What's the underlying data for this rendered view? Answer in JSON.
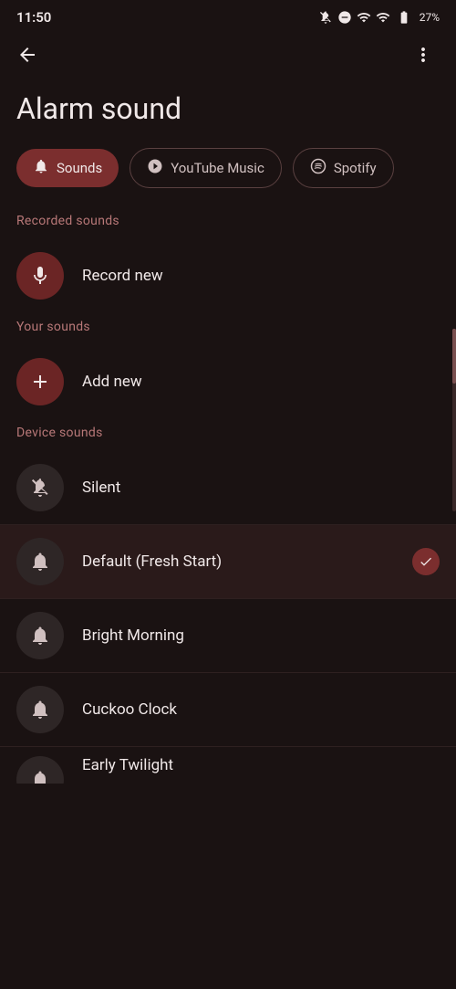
{
  "statusBar": {
    "time": "11:50",
    "battery": "27%"
  },
  "header": {
    "title": "Alarm sound",
    "back_label": "back",
    "more_label": "more options"
  },
  "tabs": [
    {
      "id": "sounds",
      "label": "Sounds",
      "active": true
    },
    {
      "id": "youtube-music",
      "label": "YouTube Music",
      "active": false
    },
    {
      "id": "spotify",
      "label": "Spotify",
      "active": false
    }
  ],
  "sections": {
    "recorded": {
      "header": "Recorded sounds",
      "items": [
        {
          "id": "record-new",
          "label": "Record new",
          "iconType": "mic"
        }
      ]
    },
    "your": {
      "header": "Your sounds",
      "items": [
        {
          "id": "add-new",
          "label": "Add new",
          "iconType": "plus"
        }
      ]
    },
    "device": {
      "header": "Device sounds",
      "items": [
        {
          "id": "silent",
          "label": "Silent",
          "iconType": "bell-off",
          "selected": false
        },
        {
          "id": "default",
          "label": "Default (Fresh Start)",
          "iconType": "bell",
          "selected": true
        },
        {
          "id": "bright-morning",
          "label": "Bright Morning",
          "iconType": "bell",
          "selected": false
        },
        {
          "id": "cuckoo-clock",
          "label": "Cuckoo Clock",
          "iconType": "bell",
          "selected": false
        },
        {
          "id": "early-twilight",
          "label": "Early Twilight",
          "iconType": "bell",
          "selected": false
        }
      ]
    }
  }
}
